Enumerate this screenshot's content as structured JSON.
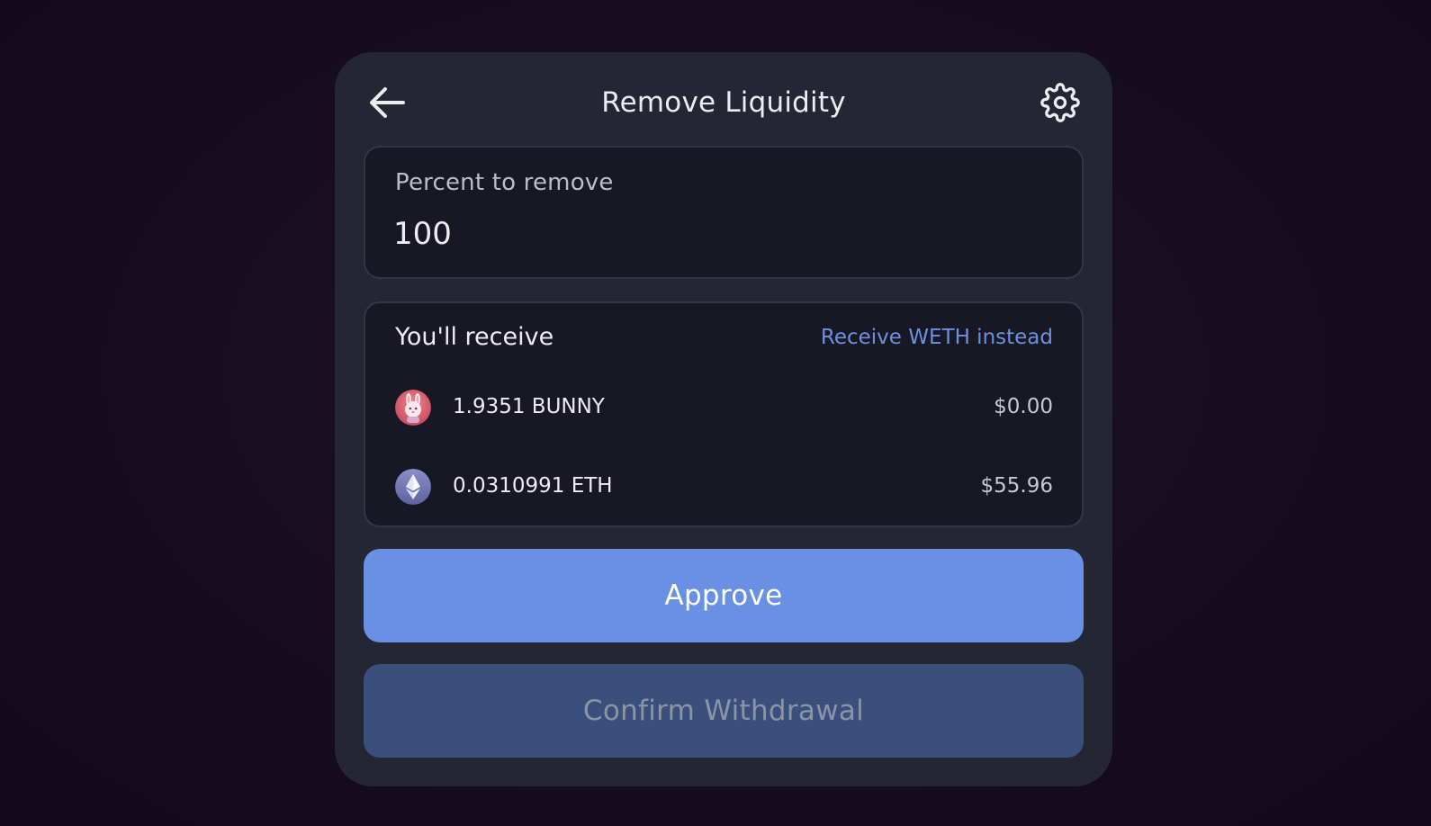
{
  "header": {
    "title": "Remove Liquidity",
    "back_icon": "arrow-left-icon",
    "settings_icon": "gear-icon"
  },
  "percent": {
    "label": "Percent to remove",
    "value": "100"
  },
  "receive": {
    "title": "You'll receive",
    "weth_link": "Receive WETH instead",
    "tokens": [
      {
        "icon": "bunny-token-icon",
        "amount": "1.9351 BUNNY",
        "value": "$0.00"
      },
      {
        "icon": "eth-token-icon",
        "amount": "0.0310991 ETH",
        "value": "$55.96"
      }
    ]
  },
  "actions": {
    "approve_label": "Approve",
    "confirm_label": "Confirm Withdrawal"
  },
  "colors": {
    "background": "#170c20",
    "card": "#252633",
    "panel": "#181824",
    "accent": "#6891E3",
    "link": "#6E91DE",
    "disabled_button": "#3A4F7C"
  }
}
